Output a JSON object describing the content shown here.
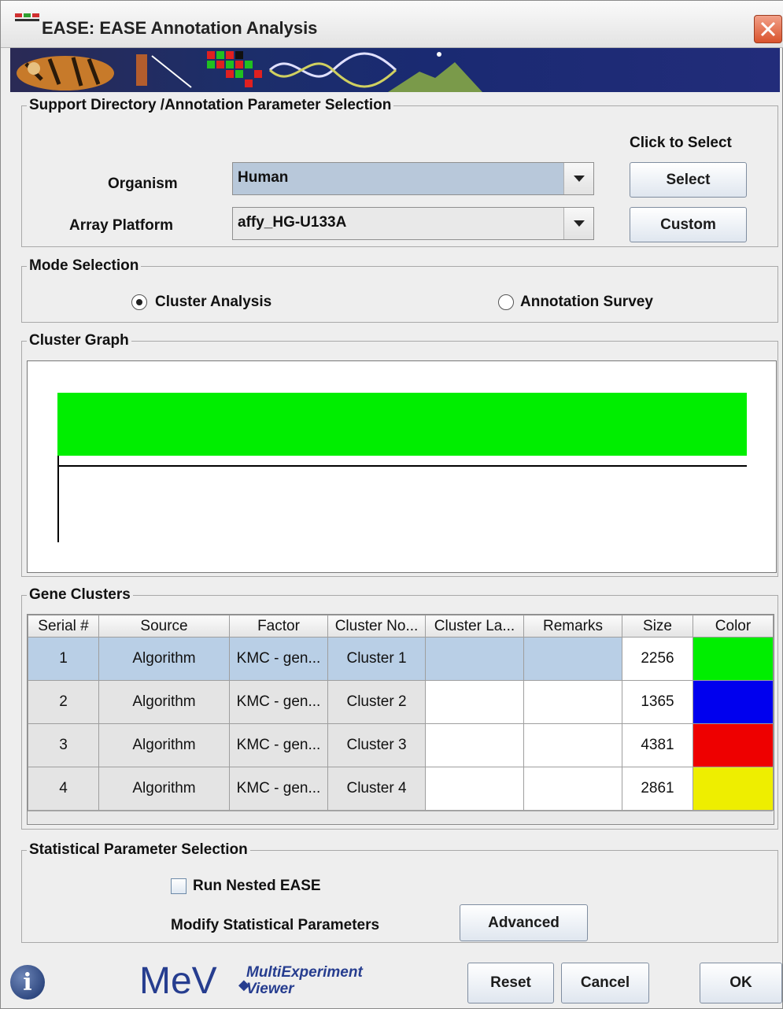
{
  "window": {
    "title": "EASE: EASE Annotation Analysis"
  },
  "support": {
    "group_title": "Support Directory /Annotation Parameter Selection",
    "click_to_select": "Click to Select",
    "organism_label": "Organism",
    "organism_value": "Human",
    "array_label": "Array Platform",
    "array_value": "affy_HG-U133A",
    "select_button": "Select",
    "custom_button": "Custom"
  },
  "mode": {
    "group_title": "Mode Selection",
    "cluster_analysis": "Cluster Analysis",
    "annotation_survey": "Annotation Survey",
    "selected": "Cluster Analysis"
  },
  "graph": {
    "group_title": "Cluster Graph",
    "bar_color": "#00ee00"
  },
  "clusters": {
    "group_title": "Gene Clusters",
    "columns": [
      "Serial #",
      "Source",
      "Factor",
      "Cluster No...",
      "Cluster La...",
      "Remarks",
      "Size",
      "Color"
    ],
    "rows": [
      {
        "serial": "1",
        "source": "Algorithm",
        "factor": "KMC - gen...",
        "cluster": "Cluster 1",
        "label": "",
        "remarks": "",
        "size": "2256",
        "color": "#00ee00"
      },
      {
        "serial": "2",
        "source": "Algorithm",
        "factor": "KMC - gen...",
        "cluster": "Cluster 2",
        "label": "",
        "remarks": "",
        "size": "1365",
        "color": "#0000ee"
      },
      {
        "serial": "3",
        "source": "Algorithm",
        "factor": "KMC - gen...",
        "cluster": "Cluster 3",
        "label": "",
        "remarks": "",
        "size": "4381",
        "color": "#ee0000"
      },
      {
        "serial": "4",
        "source": "Algorithm",
        "factor": "KMC - gen...",
        "cluster": "Cluster 4",
        "label": "",
        "remarks": "",
        "size": "2861",
        "color": "#eeee00"
      }
    ]
  },
  "stats": {
    "group_title": "Statistical Parameter Selection",
    "nested_ease": "Run Nested EASE",
    "modify_label": "Modify Statistical Parameters",
    "advanced_button": "Advanced"
  },
  "footer": {
    "logo_main": "MeV",
    "logo_sub_1": "MultiExperiment",
    "logo_sub_2": "Viewer",
    "reset_button": "Reset",
    "cancel_button": "Cancel",
    "ok_button": "OK"
  }
}
